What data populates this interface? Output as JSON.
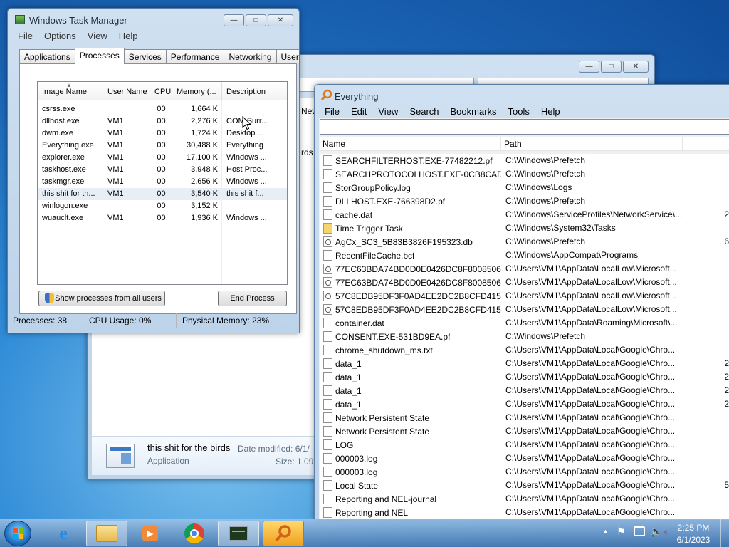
{
  "taskmgr": {
    "title": "Windows Task Manager",
    "menu": [
      "File",
      "Options",
      "View",
      "Help"
    ],
    "tabs": [
      "Applications",
      "Processes",
      "Services",
      "Performance",
      "Networking",
      "Users"
    ],
    "columns": [
      "Image Name",
      "User Name",
      "CPU",
      "Memory (...",
      "Description"
    ],
    "rows": [
      {
        "name": "csrss.exe",
        "user": "",
        "cpu": "00",
        "mem": "1,664 K",
        "desc": ""
      },
      {
        "name": "dllhost.exe",
        "user": "VM1",
        "cpu": "00",
        "mem": "2,276 K",
        "desc": "COM Surr..."
      },
      {
        "name": "dwm.exe",
        "user": "VM1",
        "cpu": "00",
        "mem": "1,724 K",
        "desc": "Desktop ..."
      },
      {
        "name": "Everything.exe",
        "user": "VM1",
        "cpu": "00",
        "mem": "30,488 K",
        "desc": "Everything"
      },
      {
        "name": "explorer.exe",
        "user": "VM1",
        "cpu": "00",
        "mem": "17,100 K",
        "desc": "Windows ..."
      },
      {
        "name": "taskhost.exe",
        "user": "VM1",
        "cpu": "00",
        "mem": "3,948 K",
        "desc": "Host Proc..."
      },
      {
        "name": "taskmgr.exe",
        "user": "VM1",
        "cpu": "00",
        "mem": "2,656 K",
        "desc": "Windows ..."
      },
      {
        "name": "this shit for th...",
        "user": "VM1",
        "cpu": "00",
        "mem": "3,540 K",
        "desc": "this shit f..."
      },
      {
        "name": "winlogon.exe",
        "user": "",
        "cpu": "00",
        "mem": "3,152 K",
        "desc": ""
      },
      {
        "name": "wuauclt.exe",
        "user": "VM1",
        "cpu": "00",
        "mem": "1,936 K",
        "desc": "Windows ..."
      }
    ],
    "show_all_label": "Show processes from all users",
    "end_process_label": "End Process",
    "status": {
      "processes": "Processes: 38",
      "cpu": "CPU Usage: 0%",
      "memory": "Physical Memory: 23%"
    }
  },
  "explorer": {
    "partial_text_1": "New",
    "partial_text_2": "rds",
    "details": {
      "name": "this shit for the birds",
      "type": "Application",
      "date_label": "Date modified: 6/1/",
      "size_label": "Size: 1.09"
    }
  },
  "everything": {
    "title": "Everything",
    "menu": [
      "File",
      "Edit",
      "View",
      "Search",
      "Bookmarks",
      "Tools",
      "Help"
    ],
    "search_value": "",
    "columns": [
      "Name",
      "Path"
    ],
    "rows": [
      {
        "name": "SEARCHFILTERHOST.EXE-77482212.pf",
        "path": "C:\\Windows\\Prefetch",
        "size": "",
        "icon": "file"
      },
      {
        "name": "SEARCHPROTOCOLHOST.EXE-0CB8CADE...",
        "path": "C:\\Windows\\Prefetch",
        "size": "",
        "icon": "file"
      },
      {
        "name": "StorGroupPolicy.log",
        "path": "C:\\Windows\\Logs",
        "size": "",
        "icon": "file"
      },
      {
        "name": "DLLHOST.EXE-766398D2.pf",
        "path": "C:\\Windows\\Prefetch",
        "size": "",
        "icon": "file"
      },
      {
        "name": "cache.dat",
        "path": "C:\\Windows\\ServiceProfiles\\NetworkService\\...",
        "size": "2",
        "icon": "file"
      },
      {
        "name": "Time Trigger Task",
        "path": "C:\\Windows\\System32\\Tasks",
        "size": "",
        "icon": "lock"
      },
      {
        "name": "AgCx_SC3_5B83B3826F195323.db",
        "path": "C:\\Windows\\Prefetch",
        "size": "6",
        "icon": "gear"
      },
      {
        "name": "RecentFileCache.bcf",
        "path": "C:\\Windows\\AppCompat\\Programs",
        "size": "",
        "icon": "file"
      },
      {
        "name": "77EC63BDA74BD0D0E0426DC8F8008506",
        "path": "C:\\Users\\VM1\\AppData\\LocalLow\\Microsoft...",
        "size": "",
        "icon": "gear"
      },
      {
        "name": "77EC63BDA74BD0D0E0426DC8F8008506",
        "path": "C:\\Users\\VM1\\AppData\\LocalLow\\Microsoft...",
        "size": "",
        "icon": "gear"
      },
      {
        "name": "57C8EDB95DF3F0AD4EE2DC2B8CFD4157",
        "path": "C:\\Users\\VM1\\AppData\\LocalLow\\Microsoft...",
        "size": "",
        "icon": "gear"
      },
      {
        "name": "57C8EDB95DF3F0AD4EE2DC2B8CFD4157",
        "path": "C:\\Users\\VM1\\AppData\\LocalLow\\Microsoft...",
        "size": "",
        "icon": "gear"
      },
      {
        "name": "container.dat",
        "path": "C:\\Users\\VM1\\AppData\\Roaming\\Microsoft\\...",
        "size": "",
        "icon": "file"
      },
      {
        "name": "CONSENT.EXE-531BD9EA.pf",
        "path": "C:\\Windows\\Prefetch",
        "size": "",
        "icon": "file"
      },
      {
        "name": "chrome_shutdown_ms.txt",
        "path": "C:\\Users\\VM1\\AppData\\Local\\Google\\Chro...",
        "size": "",
        "icon": "file"
      },
      {
        "name": "data_1",
        "path": "C:\\Users\\VM1\\AppData\\Local\\Google\\Chro...",
        "size": "2",
        "icon": "file"
      },
      {
        "name": "data_1",
        "path": "C:\\Users\\VM1\\AppData\\Local\\Google\\Chro...",
        "size": "2",
        "icon": "file"
      },
      {
        "name": "data_1",
        "path": "C:\\Users\\VM1\\AppData\\Local\\Google\\Chro...",
        "size": "2",
        "icon": "file"
      },
      {
        "name": "data_1",
        "path": "C:\\Users\\VM1\\AppData\\Local\\Google\\Chro...",
        "size": "2",
        "icon": "file"
      },
      {
        "name": "Network Persistent State",
        "path": "C:\\Users\\VM1\\AppData\\Local\\Google\\Chro...",
        "size": "",
        "icon": "file"
      },
      {
        "name": "Network Persistent State",
        "path": "C:\\Users\\VM1\\AppData\\Local\\Google\\Chro...",
        "size": "",
        "icon": "file"
      },
      {
        "name": "LOG",
        "path": "C:\\Users\\VM1\\AppData\\Local\\Google\\Chro...",
        "size": "",
        "icon": "file"
      },
      {
        "name": "000003.log",
        "path": "C:\\Users\\VM1\\AppData\\Local\\Google\\Chro...",
        "size": "",
        "icon": "file"
      },
      {
        "name": "000003.log",
        "path": "C:\\Users\\VM1\\AppData\\Local\\Google\\Chro...",
        "size": "",
        "icon": "file"
      },
      {
        "name": "Local State",
        "path": "C:\\Users\\VM1\\AppData\\Local\\Google\\Chro...",
        "size": "5",
        "icon": "file"
      },
      {
        "name": "Reporting and NEL-journal",
        "path": "C:\\Users\\VM1\\AppData\\Local\\Google\\Chro...",
        "size": "",
        "icon": "file"
      },
      {
        "name": "Reporting and NEL",
        "path": "C:\\Users\\VM1\\AppData\\Local\\Google\\Chro...",
        "size": "",
        "icon": "file"
      }
    ]
  },
  "taskbar": {
    "time": "2:25 PM",
    "date": "6/1/2023",
    "pinned": [
      "start-orb-icon",
      "internet-explorer-icon",
      "windows-explorer-icon",
      "media-player-icon",
      "chrome-icon",
      "task-manager-icon",
      "everything-icon"
    ]
  }
}
